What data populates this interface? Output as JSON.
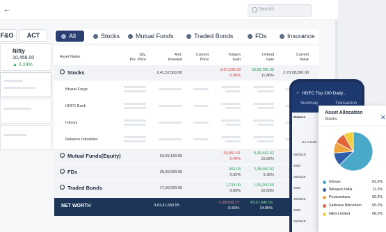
{
  "search": {
    "placeholder": "Search"
  },
  "left_tabs": [
    "F&O",
    "ACT"
  ],
  "nifty": {
    "name": "Nifty",
    "value": "10,456.00",
    "change": "▲ 0.24%"
  },
  "filters": [
    "All",
    "Stocks",
    "Mutual Funds",
    "Traded Bonds",
    "FDs",
    "Insurance"
  ],
  "table": {
    "headers": {
      "asset": "Asset Name",
      "qty": [
        "Qty.",
        "Pur. Price"
      ],
      "amt": [
        "Amt.",
        "Invested"
      ],
      "current": [
        "Current",
        "Price"
      ],
      "today": [
        "Today's",
        "Gain"
      ],
      "overall": [
        "Overall",
        "Gain"
      ],
      "value": [
        "Current",
        "Value"
      ]
    },
    "stocks": {
      "label": "Stocks",
      "invested": "2,41,52,500.00",
      "today": "-2,07,500.00",
      "today_pct": "-0.98%",
      "overall": "28,65,780.00",
      "overall_pct": "11.86%",
      "value": "2,70,28,280.00",
      "holdings": [
        "Bharat Forge",
        "HDFC Bank",
        "Infosys",
        "Reliance Industries"
      ]
    },
    "groups": [
      {
        "label": "Mutual Funds(Equity)",
        "invested": "53,09,150.55",
        "today": "-30,051.61",
        "today_pct": "-0.49%",
        "overall": "8,39,442.02",
        "overall_pct": "15.82%"
      },
      {
        "label": "FDs",
        "invested": "25,00,000.00",
        "today": "303.03",
        "today_pct": "0.02%",
        "overall": "2,38,450.02",
        "overall_pct": "9.35%"
      },
      {
        "label": "Traded Bonds",
        "invested": "17,00,000.00",
        "today": "1,734.00",
        "today_pct": "0.09%",
        "overall": "1,09,200.50",
        "overall_pct": "10.55%"
      }
    ],
    "networth": {
      "label": "NET WORTH",
      "invested": "4,63,41,650.55",
      "today": "-1,99,503.17",
      "today_pct": "-0.55%",
      "overall": "43,67,840.56",
      "overall_pct": "14.85%"
    }
  },
  "phone": {
    "title": "HDFC Top 200 Daily...",
    "tabs": [
      "Summary",
      "Transaction"
    ],
    "balance_label": "Balance",
    "goto": "Go to Date",
    "dates": [
      "06/03/18",
      "2000",
      "06/01/18",
      "2000",
      "05/03/18",
      "2000",
      "06/03/18",
      "2000",
      "04/03/18",
      "2000"
    ]
  },
  "popup": {
    "title": "Asset Allocation",
    "subtitle": "Stocks",
    "items": [
      {
        "name": "Infosys",
        "pct": "63.2%",
        "color": "#4aa8c8"
      },
      {
        "name": "Welspun India",
        "pct": "11.2%",
        "color": "#2f5fa8"
      },
      {
        "name": "Puravankara",
        "pct": "09.2%",
        "color": "#f0a33a"
      },
      {
        "name": "Sadhana Nitrochem",
        "pct": "09.2%",
        "color": "#e0653a"
      },
      {
        "name": "HEG Limited",
        "pct": "08.2%",
        "color": "#f2cf3a"
      }
    ]
  }
}
